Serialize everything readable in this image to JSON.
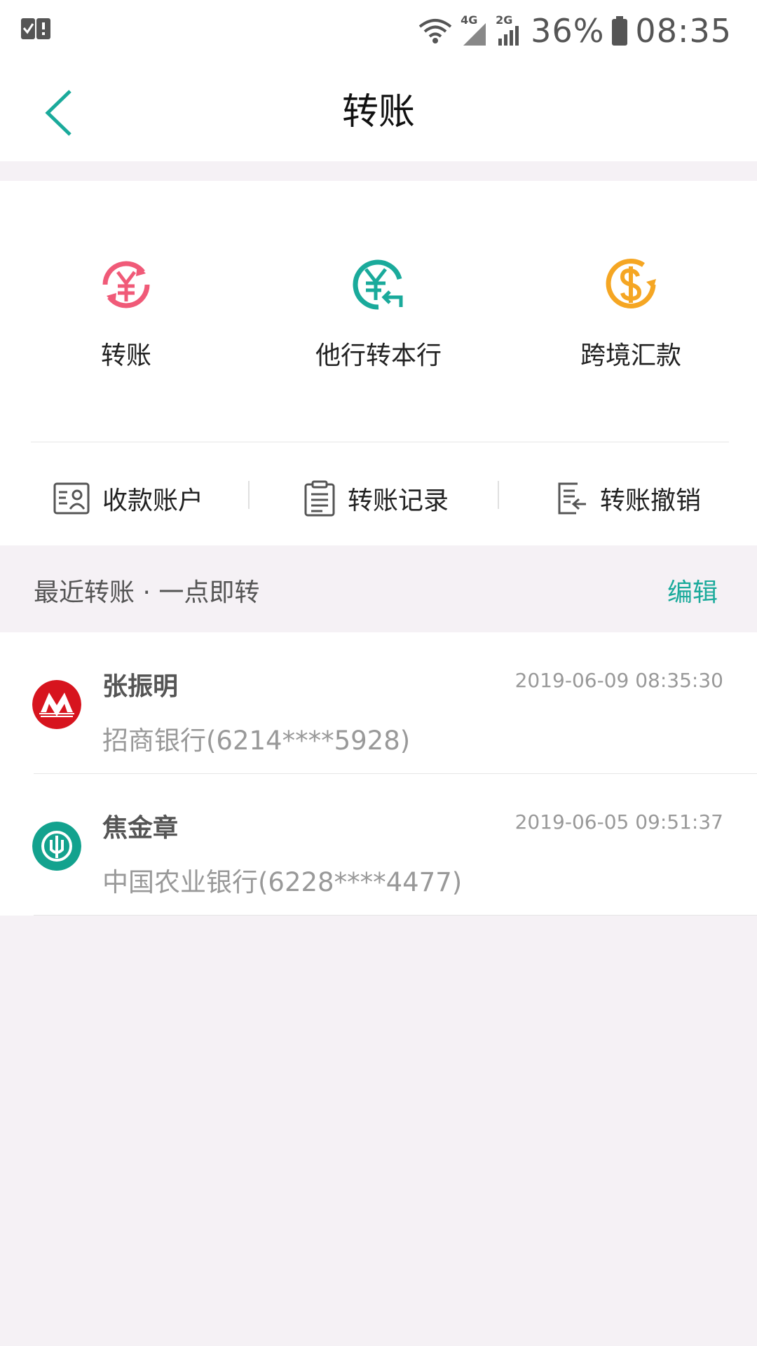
{
  "status_bar": {
    "network_4g": "4G",
    "network_2g": "2G",
    "battery": "36%",
    "time": "08:35"
  },
  "header": {
    "title": "转账"
  },
  "services": [
    {
      "label": "转账",
      "icon": "yuan-transfer-icon",
      "color": "#f05a78"
    },
    {
      "label": "他行转本行",
      "icon": "yuan-receive-icon",
      "color": "#1aaa9b"
    },
    {
      "label": "跨境汇款",
      "icon": "dollar-remit-icon",
      "color": "#f5a623"
    }
  ],
  "quick_links": [
    {
      "label": "收款账户",
      "icon": "payee-account-icon"
    },
    {
      "label": "转账记录",
      "icon": "clipboard-record-icon"
    },
    {
      "label": "转账撤销",
      "icon": "revoke-transfer-icon"
    }
  ],
  "recent": {
    "title": "最近转账 · 一点即转",
    "edit_label": "编辑",
    "items": [
      {
        "name": "张振明",
        "time": "2019-06-09 08:35:30",
        "account": "招商银行(6214****5928)",
        "bank_icon": "cmb-logo-icon",
        "bank_color": "#d7141e"
      },
      {
        "name": "焦金章",
        "time": "2019-06-05 09:51:37",
        "account": "中国农业银行(6228****4477)",
        "bank_icon": "abc-logo-icon",
        "bank_color": "#13a28e"
      }
    ]
  },
  "colors": {
    "accent": "#1aaa9b",
    "background": "#f5f1f5"
  }
}
